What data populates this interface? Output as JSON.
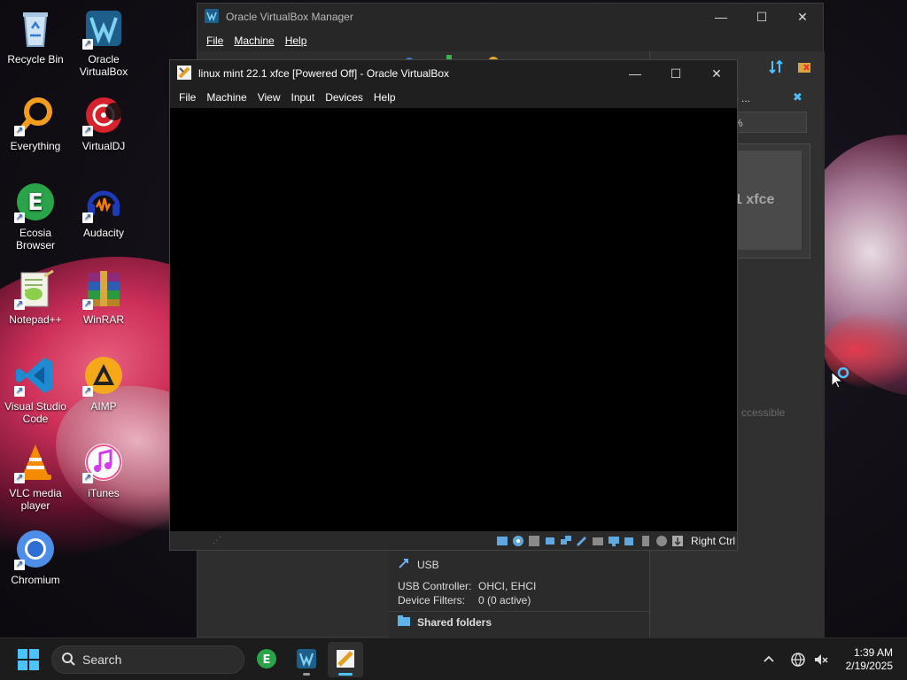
{
  "desktop": {
    "icons": [
      {
        "label": "Recycle Bin"
      },
      {
        "label": "Oracle VirtualBox"
      },
      {
        "label": "Everything"
      },
      {
        "label": "VirtualDJ"
      },
      {
        "label": "Ecosia Browser"
      },
      {
        "label": "Audacity"
      },
      {
        "label": "Notepad++"
      },
      {
        "label": "WinRAR"
      },
      {
        "label": "Visual Studio Code"
      },
      {
        "label": "AIMP"
      },
      {
        "label": "VLC media player"
      },
      {
        "label": "iTunes"
      },
      {
        "label": "Chromium"
      }
    ]
  },
  "manager": {
    "title": "Oracle VirtualBox Manager",
    "menu": [
      "File",
      "Machine",
      "Help"
    ],
    "preview_text": "1 xfce",
    "inaccessible_text": "ccessible",
    "tab_fragment": "o ...",
    "pct_fragment": "%",
    "usb": {
      "heading": "USB",
      "controller_label": "USB Controller:",
      "controller_value": "OHCI, EHCI",
      "filters_label": "Device Filters:",
      "filters_value": "0 (0 active)"
    },
    "shared_folders": "Shared folders"
  },
  "vm_window": {
    "title": "linux mint 22.1 xfce [Powered Off] - Oracle VirtualBox",
    "menu": [
      "File",
      "Machine",
      "View",
      "Input",
      "Devices",
      "Help"
    ],
    "host_key": "Right Ctrl"
  },
  "taskbar": {
    "search_placeholder": "Search",
    "time": "1:39 AM",
    "date": "2/19/2025"
  },
  "colors": {
    "accent": "#4cc2ff",
    "taskbar": "#1c1c1c"
  }
}
